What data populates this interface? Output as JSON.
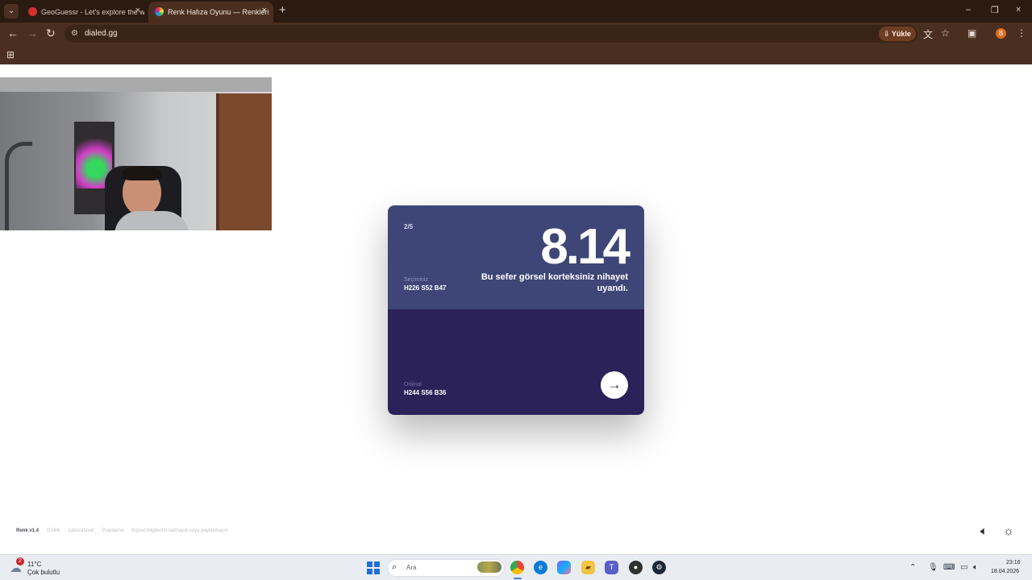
{
  "browser": {
    "tabs": [
      {
        "title": "GeoGuessr - Let's explore the world!",
        "active": false,
        "favicon_color": "#d32f2f"
      },
      {
        "title": "Renk Hafıza Oyunu — Renkleri",
        "active": true,
        "favicon_color": "#8e5ad7"
      }
    ],
    "url": "dialed.gg",
    "install_label": "Yükle",
    "profile_initial": "B",
    "icons": {
      "tab_menu": "chevron-down-icon",
      "back": "back-arrow-icon",
      "forward": "forward-arrow-icon",
      "reload": "reload-icon",
      "site_info": "site-info-icon",
      "translate": "translate-icon",
      "bookmark": "star-icon",
      "extensions": "extensions-icon",
      "menu": "kebab-menu-icon",
      "apps": "apps-grid-icon"
    }
  },
  "game": {
    "round": "2/5",
    "score": "8.14",
    "comment": "Bu sefer görsel korteksiniz nihayet uyandı.",
    "selection_label": "Seçiminiz",
    "selection_value": "H226 S52 B47",
    "original_label": "Orijinal",
    "original_value": "H244 S56 B36",
    "colors": {
      "selection": "#3e4677",
      "original": "#2a2259"
    },
    "next_icon": "arrow-right-icon"
  },
  "footer": {
    "version": "Renk v1.4",
    "links": [
      "Gizlilik",
      "Laboratuvar",
      "Puanlama",
      "Kişisel bilgilerimi satmayın veya paylaşmayın"
    ],
    "icons": [
      "speaker-icon",
      "sun-icon"
    ]
  },
  "taskbar": {
    "weather_alert": "2",
    "temperature": "11°C",
    "weather": "Çok bulutlu",
    "search_placeholder": "Ara",
    "time": "23:16",
    "date": "18.04.2026",
    "apps": [
      "chrome-icon",
      "edge-icon",
      "copilot-icon",
      "file-explorer-icon",
      "teams-icon",
      "obs-icon",
      "steam-icon"
    ]
  }
}
